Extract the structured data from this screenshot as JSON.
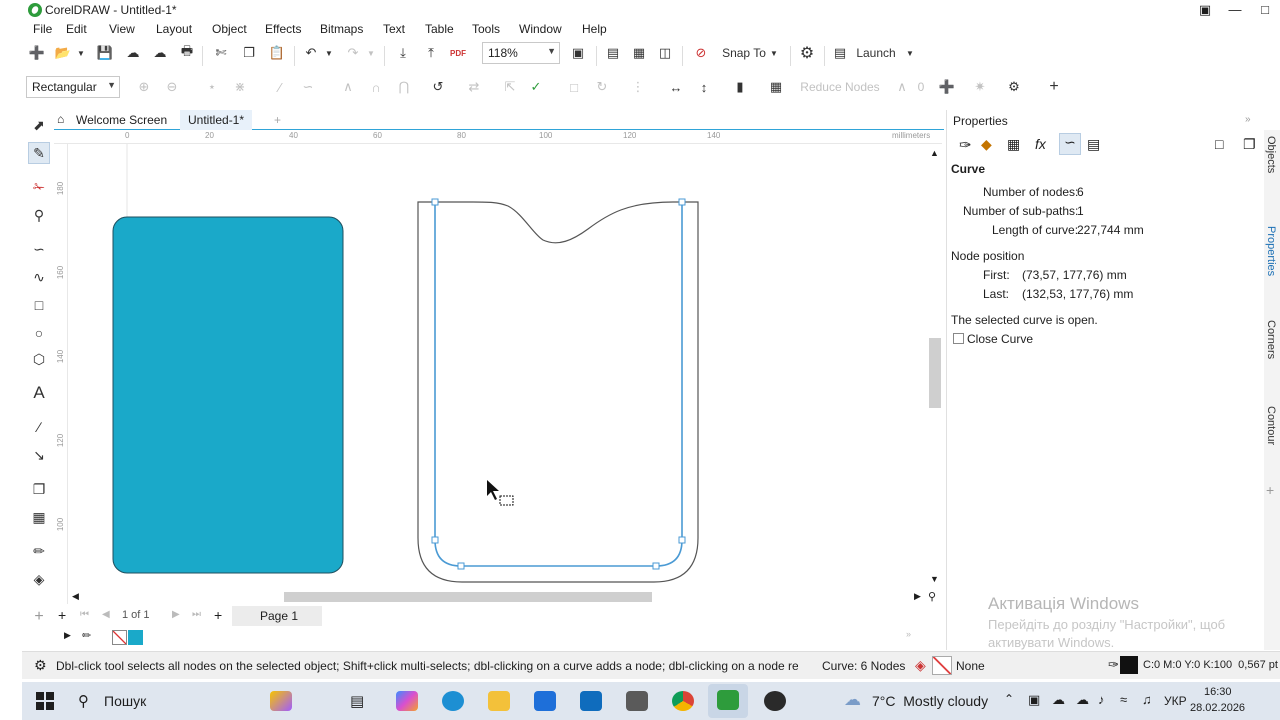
{
  "window": {
    "title": "CorelDRAW - Untitled-1*"
  },
  "menu": [
    "File",
    "Edit",
    "View",
    "Layout",
    "Object",
    "Effects",
    "Bitmaps",
    "Text",
    "Table",
    "Tools",
    "Window",
    "Help"
  ],
  "toolbar": {
    "zoom": "118%",
    "snap_to": "Snap To",
    "launch": "Launch",
    "pdf": "PDF"
  },
  "propbar": {
    "shape_mode": "Rectangular",
    "reduce_nodes": "Reduce Nodes",
    "smoothness": "0"
  },
  "tabs": {
    "welcome": "Welcome Screen",
    "doc": "Untitled-1*"
  },
  "rulers": {
    "unit": "millimeters",
    "h_ticks": [
      "0",
      "20",
      "40",
      "60",
      "80",
      "100",
      "120",
      "140"
    ],
    "v_ticks": [
      "180",
      "160",
      "140",
      "120",
      "100"
    ]
  },
  "pagenav": {
    "counter": "1 of 1",
    "page": "Page 1"
  },
  "docker": {
    "title": "Properties",
    "section": "Curve",
    "nodes_label": "Number of nodes:",
    "nodes_value": "6",
    "subpaths_label": "Number of sub-paths:",
    "subpaths_value": "1",
    "length_label": "Length of curve:",
    "length_value": "227,744 mm",
    "node_position": "Node position",
    "first_label": "First:",
    "first_value": "(73,57, 177,76) mm",
    "last_label": "Last:",
    "last_value": "(132,53, 177,76) mm",
    "open_text": "The selected curve is open.",
    "close_curve": "Close Curve",
    "side_tabs": [
      "Objects",
      "Properties",
      "Corners",
      "Contour"
    ]
  },
  "watermark": {
    "title": "Активація Windows",
    "body": "Перейдіть до розділу \"Настройки\", щоб активувати Windows."
  },
  "status": {
    "hint": "Dbl-click tool selects all nodes on the selected object; Shift+click multi-selects; dbl-clicking on a curve adds a node; dbl-clicking on a node removes it",
    "object": "Curve: 6 Nodes",
    "fill": "None",
    "outline": "C:0 M:0 Y:0 K:100  0,567 pt"
  },
  "taskbar": {
    "search": "Пошук",
    "weather": "7°C  Mostly cloudy",
    "lang": "УКР",
    "time": "16:30",
    "date": "28.02.2026"
  },
  "colors": {
    "fill_cyan": "#1aa9c9",
    "selection_blue": "#4a9ad4",
    "accent": "#2fa4d8"
  }
}
